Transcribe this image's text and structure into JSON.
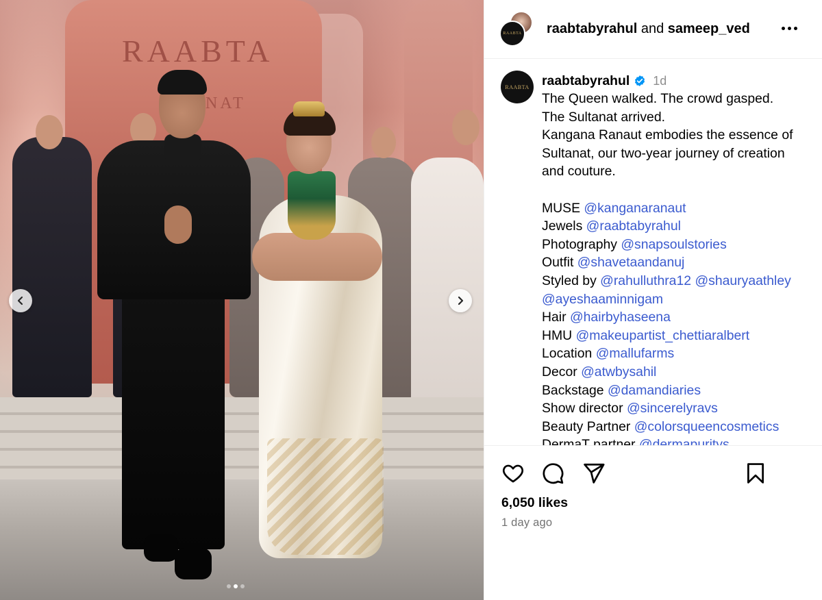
{
  "media": {
    "brand_word": "RAABTA",
    "brand_word_2": "NAT",
    "prev_button_label": "Previous image",
    "next_button_label": "Next image",
    "carousel": {
      "count": 3,
      "active_index": 1
    }
  },
  "header": {
    "user1": "raabtabyrahul",
    "connector": "and",
    "user2": "sameep_ved",
    "avatar_brand": "RAABTA"
  },
  "caption": {
    "username": "raabtabyrahul",
    "time": "1d",
    "avatar_brand": "RAABTA",
    "lines": [
      "The Queen walked. The crowd gasped.",
      "The Sultanat arrived.",
      "Kangana Ranaut embodies the essence of",
      "Sultanat, our two-year journey of creation",
      "and couture."
    ],
    "credits": [
      {
        "label": "MUSE",
        "mentions": [
          "@kanganaranaut"
        ]
      },
      {
        "label": "Jewels",
        "mentions": [
          "@raabtabyrahul"
        ]
      },
      {
        "label": "Photography",
        "mentions": [
          "@snapsoulstories"
        ]
      },
      {
        "label": "Outfit",
        "mentions": [
          "@shavetaandanuj"
        ]
      },
      {
        "label": "Styled by",
        "mentions": [
          "@rahulluthra12",
          "@shauryaathley"
        ]
      },
      {
        "label": "",
        "mentions": [
          "@ayeshaaminnigam"
        ]
      },
      {
        "label": "Hair",
        "mentions": [
          "@hairbyhaseena"
        ]
      },
      {
        "label": "HMU",
        "mentions": [
          "@makeupartist_chettiaralbert"
        ]
      },
      {
        "label": "Location",
        "mentions": [
          "@mallufarms"
        ]
      },
      {
        "label": "Decor",
        "mentions": [
          "@atwbysahil"
        ]
      },
      {
        "label": "Backstage",
        "mentions": [
          "@damandiaries"
        ]
      },
      {
        "label": "Show director",
        "mentions": [
          "@sincerelyravs"
        ]
      },
      {
        "label": "Beauty Partner",
        "mentions": [
          "@colorsqueencosmetics"
        ]
      },
      {
        "label": "DermaT partner",
        "mentions": [
          "@dermapuritys"
        ]
      }
    ]
  },
  "actions": {
    "like_icon": "heart-icon",
    "comment_icon": "comment-icon",
    "share_icon": "paper-plane-icon",
    "save_icon": "bookmark-icon"
  },
  "stats": {
    "likes": "6,050 likes",
    "posted": "1 day ago"
  },
  "colors": {
    "mention": "#3b5bcf",
    "verified": "#0095f6",
    "muted": "#737373"
  }
}
